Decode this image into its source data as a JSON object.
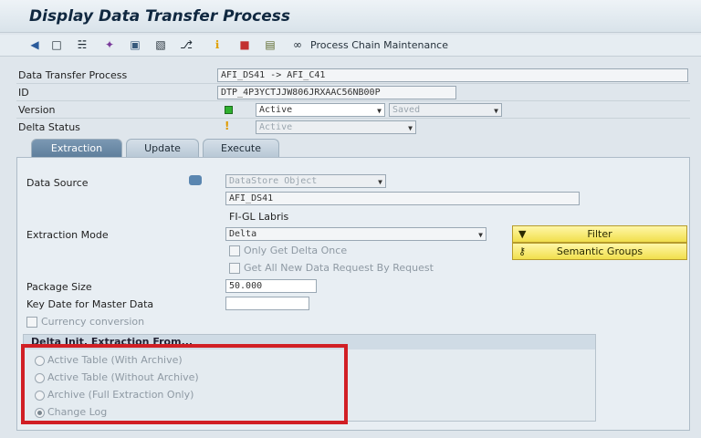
{
  "title": "Display Data Transfer Process",
  "toolbar": {
    "icons": [
      "back-arrow-icon",
      "display-icon",
      "hierarchy-icon",
      "magic-wand-icon",
      "screen-icon",
      "structure-icon",
      "tree-icon",
      "info-icon",
      "stop-icon",
      "save-icon",
      "glasses-icon"
    ],
    "process_chain_label": "Process Chain Maintenance"
  },
  "header": {
    "dtp_label": "Data Transfer Process",
    "dtp_value": "AFI_DS41  ->  AFI_C41",
    "id_label": "ID",
    "id_value": "DTP_4P3YCTJJW806JRXAAC56NB00P",
    "version_label": "Version",
    "version_value": "Active",
    "version_saved": "Saved",
    "delta_status_label": "Delta Status",
    "delta_status_value": "Active"
  },
  "tabs": [
    "Extraction",
    "Update",
    "Execute"
  ],
  "extraction": {
    "data_source_label": "Data Source",
    "data_source_type": "DataStore Object",
    "data_source_name": "AFI_DS41",
    "data_source_desc": "FI-GL Labris",
    "extraction_mode_label": "Extraction Mode",
    "extraction_mode_value": "Delta",
    "only_delta_once": "Only Get Delta Once",
    "get_all_new_data": "Get All New Data Request By Request",
    "package_size_label": "Package Size",
    "package_size_value": "50.000",
    "key_date_label": "Key Date for Master Data",
    "key_date_value": "",
    "currency_conversion": "Currency conversion",
    "filter_button": "Filter",
    "semantic_groups_button": "Semantic Groups"
  },
  "delta_init": {
    "title": "Delta Init. Extraction From...",
    "options": [
      {
        "label": "Active Table (With Archive)",
        "selected": false
      },
      {
        "label": "Active Table (Without Archive)",
        "selected": false
      },
      {
        "label": "Archive (Full Extraction Only)",
        "selected": false
      },
      {
        "label": "Change Log",
        "selected": true
      }
    ]
  },
  "colors": {
    "highlight_red": "#d11f25",
    "status_green": "#2fb02f",
    "active_tab": "#6d8ba8"
  }
}
